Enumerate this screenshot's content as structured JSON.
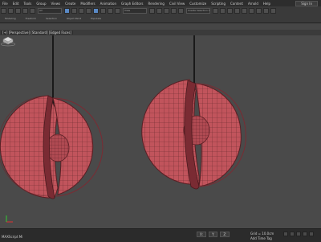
{
  "menu": {
    "items": [
      "File",
      "Edit",
      "Tools",
      "Group",
      "Views",
      "Create",
      "Modifiers",
      "Animation",
      "Graph Editors",
      "Rendering",
      "Civil View",
      "Customize",
      "Scripting",
      "Content",
      "Arnold",
      "Help"
    ],
    "sign_in": "Sign In"
  },
  "toolbar": {
    "selection_set": "Create Selection Set",
    "ribbon_labels": [
      "Modeling",
      "Freeform",
      "Selection",
      "Object Paint",
      "Populate"
    ]
  },
  "viewport": {
    "label": "[+] [Perspective] [Standard] [Edged Faces]",
    "wire_color": "#c1545c",
    "background": "#4a4a4a"
  },
  "status": {
    "left": "MAXScript Mi",
    "coords": [
      "X: ",
      "Y: ",
      "Z: "
    ],
    "grid": "Grid = 10.0cm",
    "autokey": "Add Time Tag"
  }
}
